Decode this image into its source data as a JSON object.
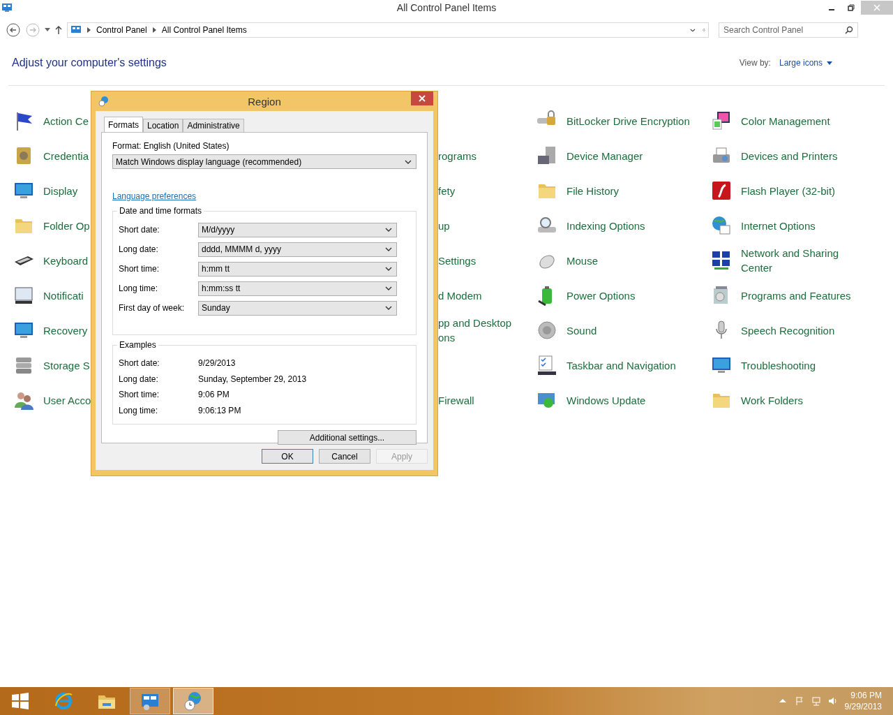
{
  "window": {
    "title": "All Control Panel Items"
  },
  "address_bar": {
    "breadcrumb": [
      "Control Panel",
      "All Control Panel Items"
    ]
  },
  "search": {
    "placeholder": "Search Control Panel"
  },
  "heading": "Adjust your computer's settings",
  "view_by": {
    "label": "View by:",
    "value": "Large icons"
  },
  "rows": [
    {
      "column_1": "Action Ce",
      "column_4": "BitLocker Drive Encryption",
      "column_5": "Color Management"
    },
    {
      "column_1": "Credentia",
      "column_3": "rograms",
      "column_4": "Device Manager",
      "column_5": "Devices and Printers"
    },
    {
      "column_1": "Display",
      "column_3": "fety",
      "column_4": "File History",
      "column_5": "Flash Player (32-bit)"
    },
    {
      "column_1": "Folder Op",
      "column_3": "up",
      "column_4": "Indexing Options",
      "column_5": "Internet Options"
    },
    {
      "column_1": "Keyboard",
      "column_3": "Settings",
      "column_4": "Mouse",
      "column_5": "Network and Sharing Center"
    },
    {
      "column_1": "Notificati",
      "column_3": "d Modem",
      "column_4": "Power Options",
      "column_5": "Programs and Features"
    },
    {
      "column_1": "Recovery",
      "column_3": "pp and Desktop ons",
      "column_4": "Sound",
      "column_5": "Speech Recognition"
    },
    {
      "column_1": "Storage S",
      "column_4": "Taskbar and Navigation",
      "column_5": "Troubleshooting"
    },
    {
      "column_1": "User Acco",
      "column_3": "Firewall",
      "column_4": "Windows Update",
      "column_5": "Work Folders"
    }
  ],
  "dialog": {
    "title": "Region",
    "tabs": [
      {
        "label": "Formats",
        "selected": true
      },
      {
        "label": "Location",
        "selected": false
      },
      {
        "label": "Administrative",
        "selected": false
      }
    ],
    "format_label": "Format: English (United States)",
    "format_value": "Match Windows display language (recommended)",
    "link": "Language preferences",
    "formats_group": {
      "title": "Date and time formats",
      "rows": [
        {
          "label": "Short date:",
          "value": "M/d/yyyy"
        },
        {
          "label": "Long date:",
          "value": "dddd, MMMM d, yyyy"
        },
        {
          "label": "Short time:",
          "value": "h:mm tt"
        },
        {
          "label": "Long time:",
          "value": "h:mm:ss tt"
        },
        {
          "label": "First day of week:",
          "value": "Sunday"
        }
      ]
    },
    "examples_group": {
      "title": "Examples",
      "rows": [
        {
          "label": "Short date:",
          "value": "9/29/2013"
        },
        {
          "label": "Long date:",
          "value": "Sunday, September 29, 2013"
        },
        {
          "label": "Short time:",
          "value": "9:06 PM"
        },
        {
          "label": "Long time:",
          "value": "9:06:13 PM"
        }
      ]
    },
    "additional_button": "Additional settings...",
    "buttons": [
      {
        "label": "OK",
        "disabled": false
      },
      {
        "label": "Cancel",
        "disabled": false
      },
      {
        "label": "Apply",
        "disabled": true
      }
    ]
  },
  "taskbar": {
    "items": [
      {
        "kind": "start",
        "running": false,
        "selected": false
      },
      {
        "kind": "browser",
        "running": false,
        "selected": false
      },
      {
        "kind": "explorer",
        "running": false,
        "selected": false
      },
      {
        "kind": "control-panel",
        "running": true,
        "selected": false
      },
      {
        "kind": "region",
        "running": true,
        "selected": true
      }
    ],
    "time": "9:06 PM",
    "date": "9/29/2013"
  }
}
